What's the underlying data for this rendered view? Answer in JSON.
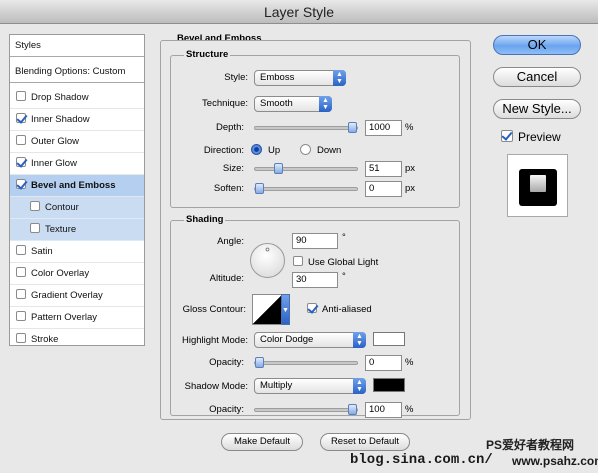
{
  "window": {
    "title": "Layer Style"
  },
  "left_panel": {
    "header": "Styles",
    "blending": "Blending Options: Custom",
    "items": [
      {
        "label": "Drop Shadow",
        "checked": false,
        "sub": false
      },
      {
        "label": "Inner Shadow",
        "checked": true,
        "sub": false
      },
      {
        "label": "Outer Glow",
        "checked": false,
        "sub": false
      },
      {
        "label": "Inner Glow",
        "checked": true,
        "sub": false
      },
      {
        "label": "Bevel and Emboss",
        "checked": true,
        "sub": false,
        "selected": true
      },
      {
        "label": "Contour",
        "checked": false,
        "sub": true
      },
      {
        "label": "Texture",
        "checked": false,
        "sub": true
      },
      {
        "label": "Satin",
        "checked": false,
        "sub": false
      },
      {
        "label": "Color Overlay",
        "checked": false,
        "sub": false
      },
      {
        "label": "Gradient Overlay",
        "checked": false,
        "sub": false
      },
      {
        "label": "Pattern Overlay",
        "checked": false,
        "sub": false
      },
      {
        "label": "Stroke",
        "checked": false,
        "sub": false
      }
    ]
  },
  "bevel": {
    "section_title": "Bevel and Emboss",
    "structure_title": "Structure",
    "style_label": "Style:",
    "style_value": "Emboss",
    "technique_label": "Technique:",
    "technique_value": "Smooth",
    "depth_label": "Depth:",
    "depth_value": "1000",
    "depth_unit": "%",
    "depth_level": 1.0,
    "direction_label": "Direction:",
    "dir_up": "Up",
    "dir_down": "Down",
    "direction_selected": "Up",
    "size_label": "Size:",
    "size_value": "51",
    "size_unit": "px",
    "size_level": 0.2,
    "soften_label": "Soften:",
    "soften_value": "0",
    "soften_unit": "px",
    "soften_level": 0.0
  },
  "shading": {
    "title": "Shading",
    "angle_label": "Angle:",
    "angle_value": "90",
    "angle_unit": "°",
    "global_light_label": "Use Global Light",
    "global_light_checked": false,
    "altitude_label": "Altitude:",
    "altitude_value": "30",
    "altitude_unit": "°",
    "gloss_label": "Gloss Contour:",
    "anti_aliased_label": "Anti-aliased",
    "anti_aliased_checked": true,
    "highlight_label": "Highlight Mode:",
    "highlight_value": "Color Dodge",
    "highlight_color": "#ffffff",
    "highlight_opacity_label": "Opacity:",
    "highlight_opacity_value": "0",
    "highlight_opacity_unit": "%",
    "highlight_opacity_level": 0.0,
    "shadow_label": "Shadow Mode:",
    "shadow_value": "Multiply",
    "shadow_color": "#000000",
    "shadow_opacity_label": "Opacity:",
    "shadow_opacity_value": "100",
    "shadow_opacity_unit": "%",
    "shadow_opacity_level": 1.0
  },
  "bottom_buttons": {
    "make_default": "Make Default",
    "reset_default": "Reset to Default"
  },
  "right_panel": {
    "ok": "OK",
    "cancel": "Cancel",
    "new_style": "New Style...",
    "preview_label": "Preview",
    "preview_checked": true
  },
  "watermark": {
    "line1": "PS爱好者教程网",
    "line2": "blog.sina.com.cn/",
    "line3": "www.psahz.com"
  }
}
